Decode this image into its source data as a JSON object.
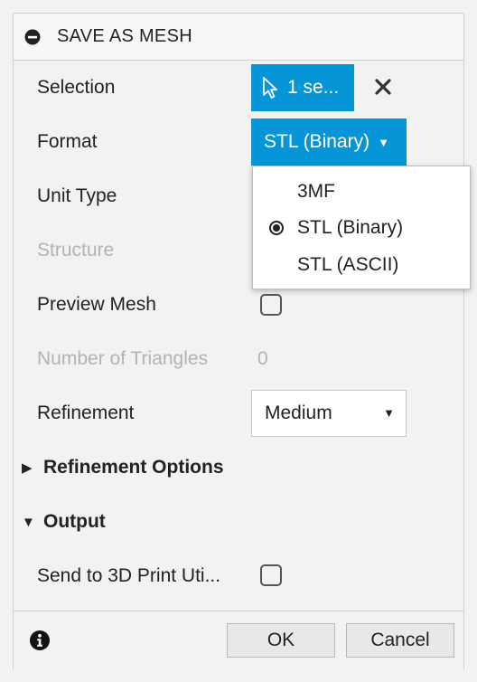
{
  "dialog": {
    "title": "SAVE AS MESH"
  },
  "fields": {
    "selection": {
      "label": "Selection",
      "button": "1 se..."
    },
    "format": {
      "label": "Format",
      "value": "STL (Binary)"
    },
    "unit_type": {
      "label": "Unit Type"
    },
    "structure": {
      "label": "Structure"
    },
    "preview_mesh": {
      "label": "Preview Mesh",
      "checked": false
    },
    "triangles": {
      "label": "Number of Triangles",
      "value": "0"
    },
    "refinement": {
      "label": "Refinement",
      "value": "Medium"
    }
  },
  "format_menu": {
    "options": [
      {
        "label": "3MF",
        "selected": false
      },
      {
        "label": "STL (Binary)",
        "selected": true
      },
      {
        "label": "STL (ASCII)",
        "selected": false
      }
    ]
  },
  "sections": {
    "refinement_options": {
      "label": "Refinement Options",
      "expanded": false
    },
    "output": {
      "label": "Output",
      "expanded": true
    }
  },
  "output": {
    "send_to_print": {
      "label": "Send to 3D Print Uti...",
      "checked": false
    }
  },
  "footer": {
    "ok": "OK",
    "cancel": "Cancel"
  },
  "colors": {
    "accent": "#0696d7",
    "background": "#f2f2f2"
  },
  "icons": {
    "title": "collapse-minus-icon",
    "selection": "cursor-arrow-icon",
    "clear": "close-x-icon",
    "info": "info-icon"
  }
}
